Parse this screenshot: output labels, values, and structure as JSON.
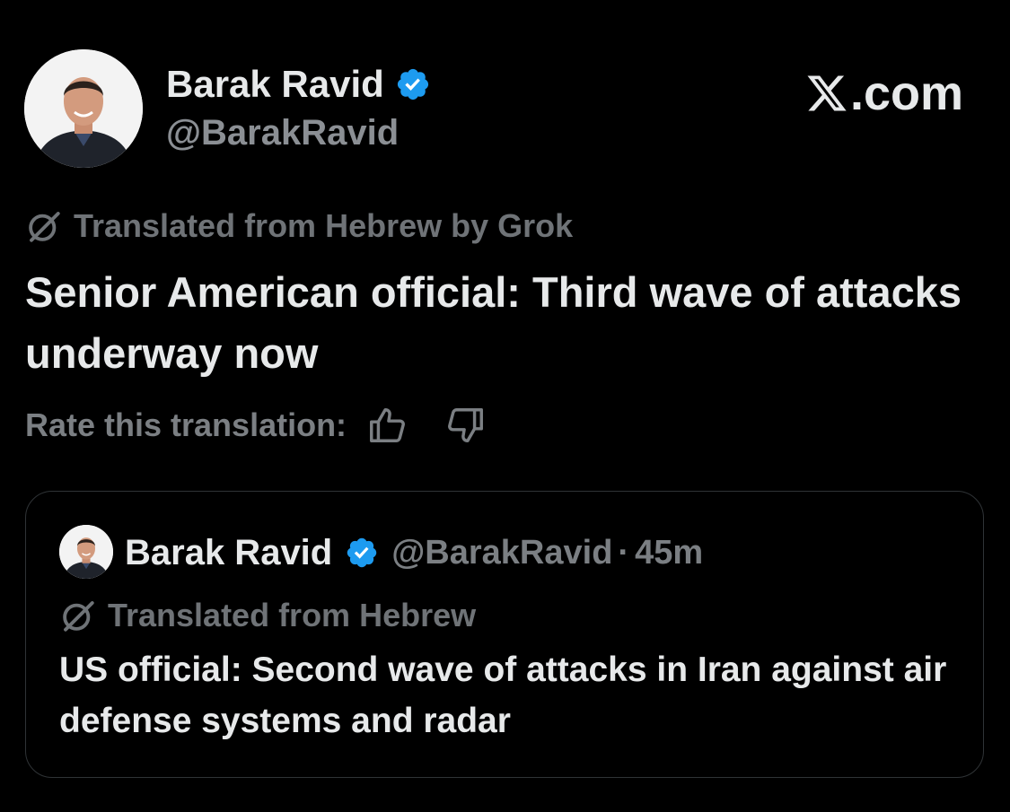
{
  "post": {
    "author": {
      "name": "Barak Ravid",
      "handle": "@BarakRavid",
      "avatar_icon": "profile-photo",
      "verified_icon": "verified-badge-icon"
    },
    "brand": {
      "text": ".com",
      "logo_icon": "x-logo-icon"
    },
    "translation_note": "Translated from Hebrew by Grok",
    "text": "Senior American official: Third wave of attacks underway now",
    "rate": {
      "label": "Rate this translation:",
      "up_icon": "thumbs-up-icon",
      "down_icon": "thumbs-down-icon"
    }
  },
  "quote": {
    "author": {
      "name": "Barak Ravid",
      "handle": "@BarakRavid",
      "separator": "·",
      "time": "45m"
    },
    "translation_note": "Translated from Hebrew",
    "text": "US official: Second wave of attacks in Iran against air defense systems and radar"
  },
  "colors": {
    "background": "#000000",
    "text_primary": "#e7e9ea",
    "text_secondary": "#7b7f83",
    "verified": "#1d9bf0",
    "border": "#2f3336"
  }
}
